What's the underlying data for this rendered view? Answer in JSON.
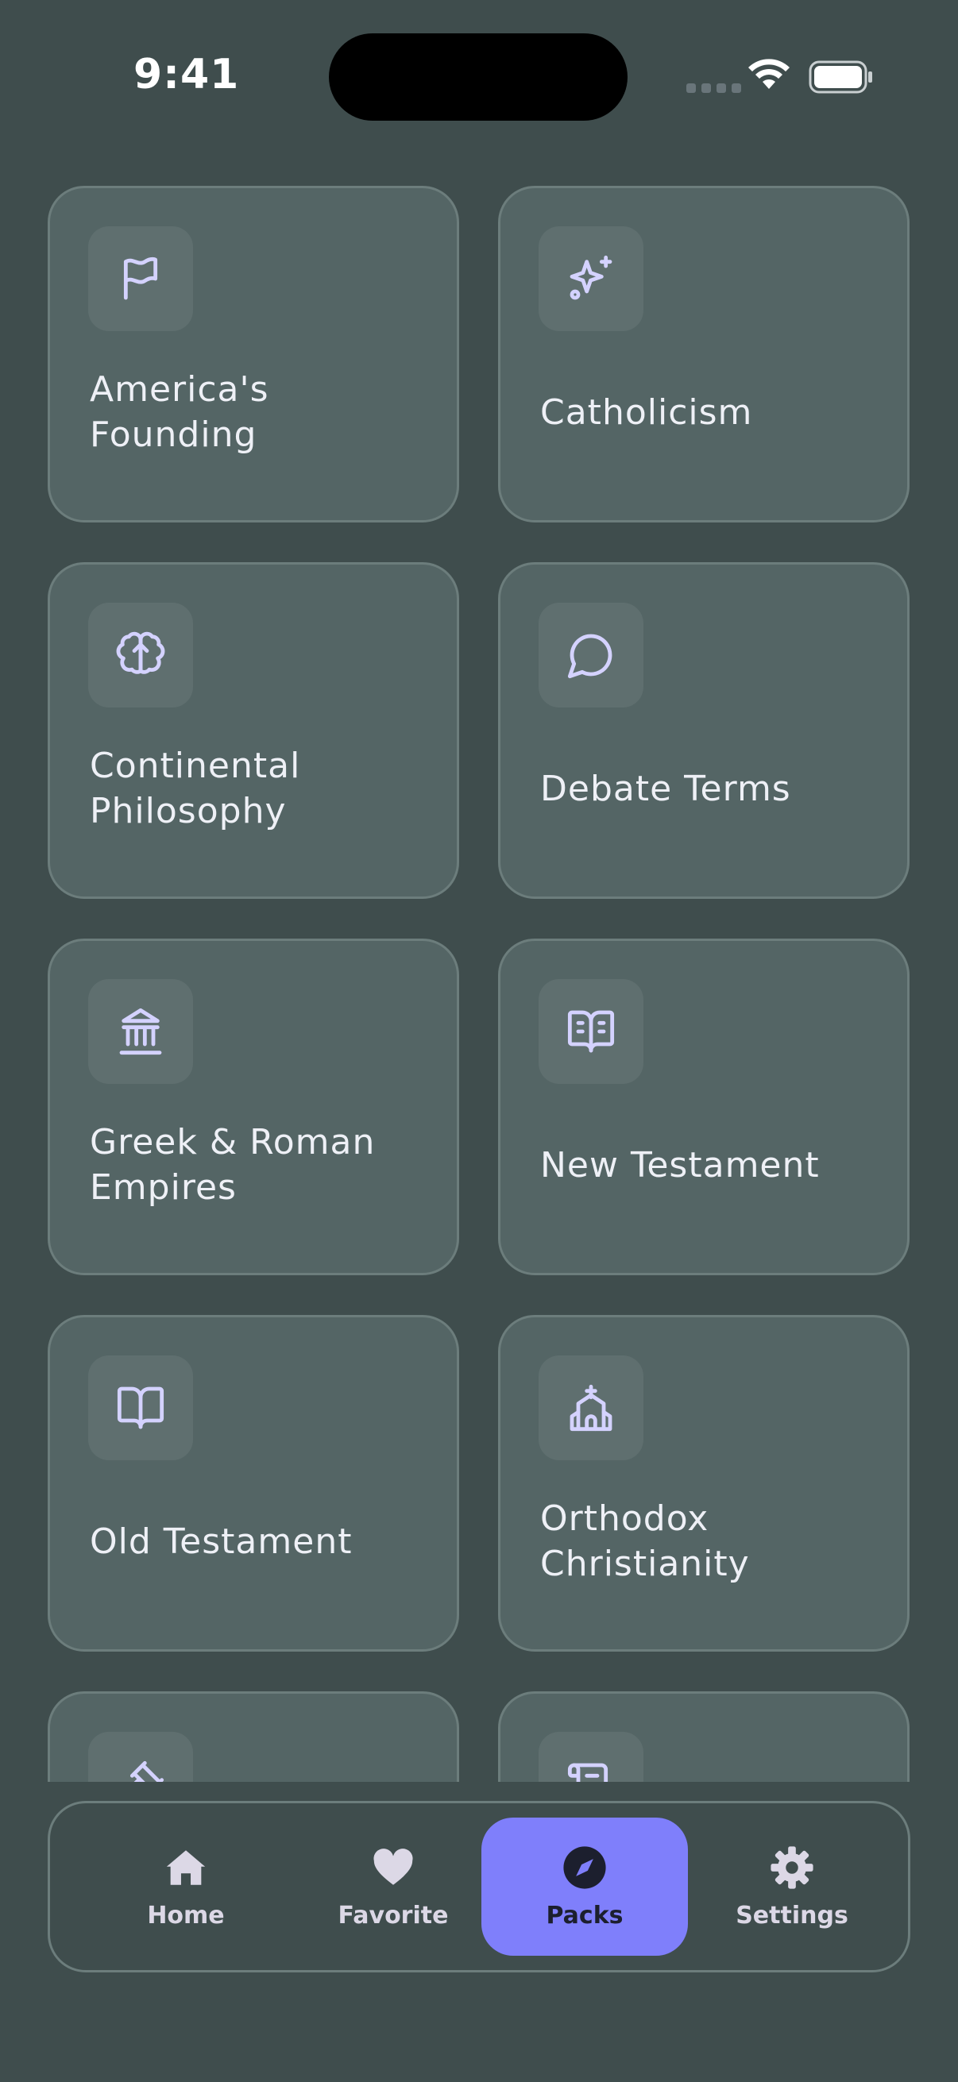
{
  "status_bar": {
    "time": "9:41"
  },
  "packs": [
    {
      "title": "America's\nFounding",
      "icon": "flag-icon"
    },
    {
      "title": "Catholicism",
      "icon": "sparkles-icon"
    },
    {
      "title": "Continental\nPhilosophy",
      "icon": "brain-icon"
    },
    {
      "title": "Debate Terms",
      "icon": "chat-bubble-icon"
    },
    {
      "title": "Greek & Roman\nEmpires",
      "icon": "landmark-icon"
    },
    {
      "title": "New Testament",
      "icon": "open-book-text-icon"
    },
    {
      "title": "Old Testament",
      "icon": "open-book-icon"
    },
    {
      "title": "Orthodox\nChristianity",
      "icon": "church-icon"
    },
    {
      "title": "",
      "icon": "gavel-icon"
    },
    {
      "title": "",
      "icon": "scroll-icon"
    }
  ],
  "nav": {
    "items": [
      {
        "label": "Home",
        "icon": "home-icon"
      },
      {
        "label": "Favorite",
        "icon": "heart-icon"
      },
      {
        "label": "Packs",
        "icon": "compass-icon"
      },
      {
        "label": "Settings",
        "icon": "gear-icon"
      }
    ],
    "active": "Packs"
  },
  "colors": {
    "background": "#3f4d4d",
    "card": "#546565",
    "icon_stroke": "#d4d2ff",
    "accent": "#7f7ffb"
  }
}
